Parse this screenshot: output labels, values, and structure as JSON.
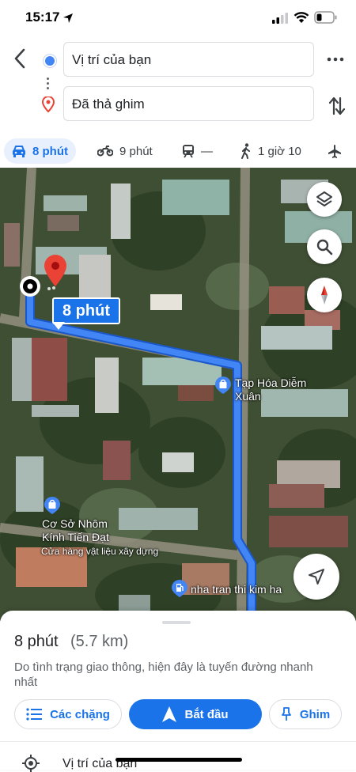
{
  "status_bar": {
    "time": "15:17"
  },
  "route": {
    "origin": "Vị trí của bạn",
    "destination": "Đã thả ghim"
  },
  "modes": [
    {
      "icon": "car-icon",
      "label": "8 phút",
      "selected": true
    },
    {
      "icon": "motorbike-icon",
      "label": "9 phút"
    },
    {
      "icon": "transit-icon",
      "label": "—"
    },
    {
      "icon": "walk-icon",
      "label": "1 giờ 10"
    },
    {
      "icon": "flight-icon",
      "label": ""
    }
  ],
  "map": {
    "route_time_label": "8 phút",
    "places": [
      {
        "name": "Tạp Hóa Diễm Xuân",
        "line1": "Tạp Hóa Diễm",
        "line2": "Xuân"
      },
      {
        "name": "Cơ Sở Nhôm Kính Tiến Đạt",
        "line1": "Cơ Sở Nhôm",
        "line2": "Kính Tiến Đạt",
        "sub": "Cửa hàng vật liệu xây dựng"
      },
      {
        "name": "nha tran thi kim ha"
      }
    ],
    "route_color": "#4285f4"
  },
  "sheet": {
    "duration": "8 phút",
    "distance": "(5.7 km)",
    "note": "Do tình trạng giao thông, hiện đây là tuyến đường nhanh nhất",
    "buttons": {
      "steps": "Các chặng",
      "start": "Bắt đầu",
      "pin": "Ghim"
    },
    "list_item": "Vị trí của bạn"
  }
}
